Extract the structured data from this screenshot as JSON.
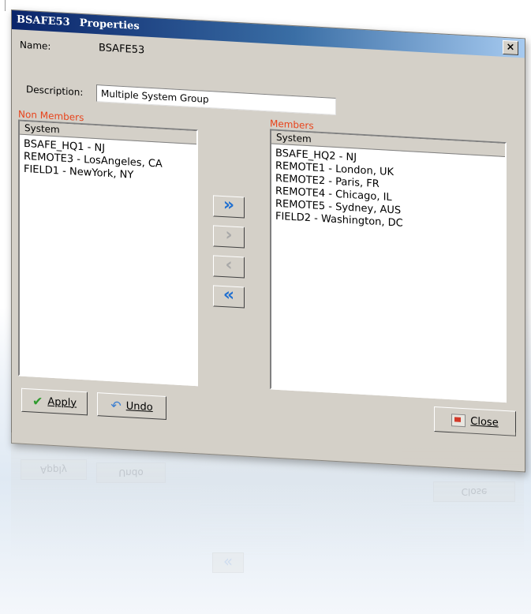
{
  "window": {
    "title_name": "BSAFE53",
    "title_suffix": "Properties",
    "close_glyph": "×"
  },
  "form": {
    "name_label": "Name:",
    "name_value": "BSAFE53",
    "description_label": "Description:",
    "description_value": "Multiple System Group"
  },
  "non_members": {
    "label": "Non Members",
    "column_header": "System",
    "items": [
      "BSAFE_HQ1 - NJ",
      "REMOTE3 - LosAngeles, CA",
      "FIELD1 - NewYork, NY"
    ]
  },
  "members": {
    "label": "Members",
    "column_header": "System",
    "items": [
      "BSAFE_HQ2 - NJ",
      "REMOTE1 - London, UK",
      "REMOTE2 - Paris, FR",
      "REMOTE4 - Chicago, IL",
      "REMOTE5 - Sydney, AUS",
      "FIELD2 - Washington, DC"
    ]
  },
  "transfer_buttons": {
    "add_all": "»",
    "add_one": "›",
    "remove_one": "‹",
    "remove_all": "«"
  },
  "buttons": {
    "apply_label": "Apply",
    "undo_label": "Undo",
    "close_label": "Close"
  },
  "reflection": {
    "apply_label": "Apply",
    "undo_label": "Undo",
    "close_label": "Close",
    "remove_all": "«"
  },
  "icons": {
    "apply": "check-icon",
    "undo": "undo-icon",
    "close": "close-door-icon"
  },
  "colors": {
    "title_start": "#0a246a",
    "title_end": "#a6caf0",
    "group_label": "#e8431b",
    "arrow_active": "#1f6fd1",
    "arrow_disabled": "#a8a8a8",
    "window_face": "#d4d0c8"
  }
}
